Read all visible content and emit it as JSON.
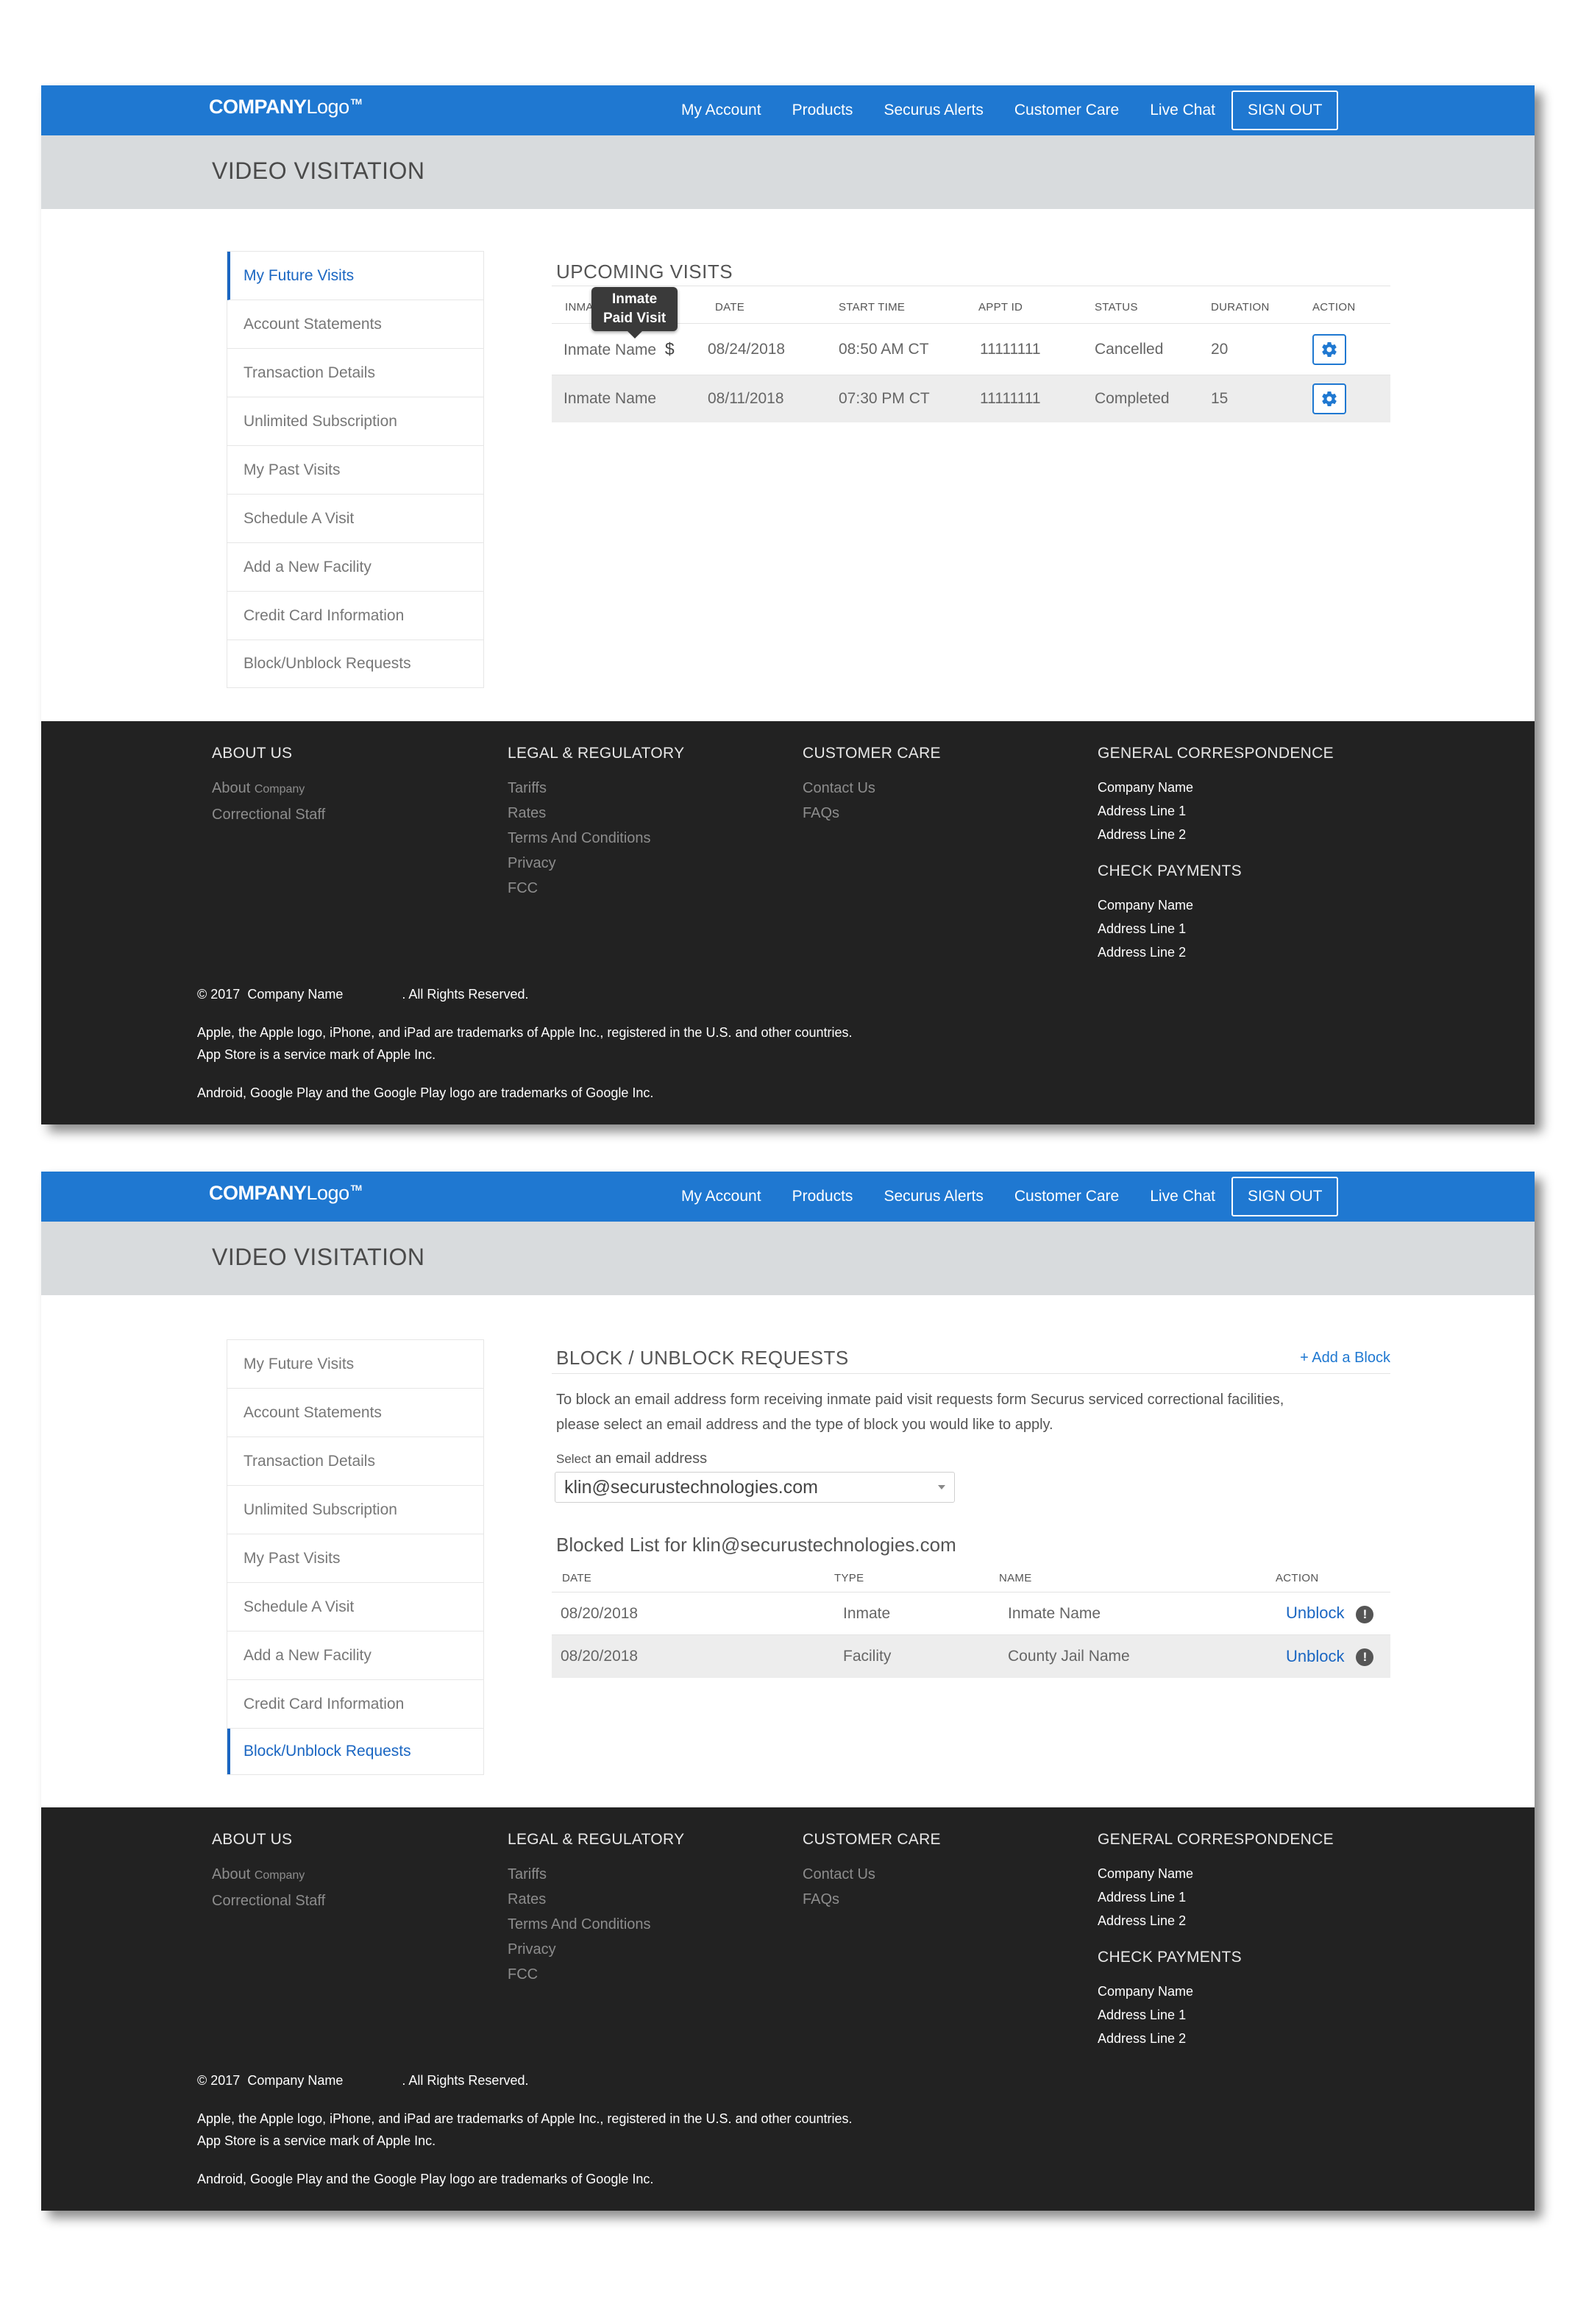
{
  "header": {
    "logo_bold": "COMPANY",
    "logo_light": "Logo",
    "logo_tm": "TM",
    "nav": [
      "My Account",
      "Products",
      "Securus Alerts",
      "Customer Care",
      "Live Chat"
    ],
    "sign_out": "SIGN OUT"
  },
  "page_title": "VIDEO VISITATION",
  "sidebar": {
    "items": [
      "My Future Visits",
      "Account Statements",
      "Transaction Details",
      "Unlimited Subscription",
      "My Past Visits",
      "Schedule A Visit",
      "Add a New Facility",
      "Credit Card Information",
      "Block/Unblock Requests"
    ]
  },
  "screen1": {
    "active_item": "My Future Visits",
    "title": "UPCOMING VISITS",
    "columns": [
      "INMATE NAME",
      "DATE",
      "START TIME",
      "APPT ID",
      "STATUS",
      "DURATION",
      "ACTION"
    ],
    "rows": [
      {
        "name": "Inmate Name",
        "paid": "$",
        "date": "08/24/2018",
        "time": "08:50 AM CT",
        "appt": "11111111",
        "status": "Cancelled",
        "duration": "20"
      },
      {
        "name": "Inmate Name",
        "paid": "",
        "date": "08/11/2018",
        "time": "07:30 PM CT",
        "appt": "11111111",
        "status": "Completed",
        "duration": "15"
      }
    ],
    "tooltip_line1": "Inmate",
    "tooltip_line2": "Paid Visit"
  },
  "screen2": {
    "active_item": "Block/Unblock Requests",
    "title": "BLOCK / UNBLOCK  REQUESTS",
    "add_block": "+ Add a Block",
    "description_line1": "To block an email address form receiving inmate paid visit requests form Securus serviced correctional facilities,",
    "description_line2": "please select an email address and the type of block you would like to apply.",
    "select_label_small": "Select",
    "select_label": "an email address",
    "select_value": "klin@securustechnologies.com",
    "blocked_title": "Blocked List for klin@securustechnologies.com",
    "columns": [
      "DATE",
      "TYPE",
      "NAME",
      "ACTION"
    ],
    "rows": [
      {
        "date": "08/20/2018",
        "type": "Inmate",
        "name": "Inmate Name",
        "action": "Unblock"
      },
      {
        "date": "08/20/2018",
        "type": "Facility",
        "name": "County Jail Name",
        "action": "Unblock"
      }
    ]
  },
  "footer": {
    "about": {
      "title": "ABOUT US",
      "about_label": "About",
      "about_company": "Company",
      "staff": "Correctional Staff"
    },
    "legal": {
      "title": "LEGAL & REGULATORY",
      "links": [
        "Tariffs",
        "Rates",
        "Terms And Conditions",
        "Privacy",
        "FCC"
      ]
    },
    "care": {
      "title": "CUSTOMER CARE",
      "links": [
        "Contact Us",
        "FAQs"
      ]
    },
    "general": {
      "title": "GENERAL CORRESPONDENCE",
      "lines": [
        "Company Name",
        "Address Line 1",
        "Address Line 2"
      ]
    },
    "payments": {
      "title": "CHECK PAYMENTS",
      "lines": [
        "Company Name",
        "Address Line 1",
        "Address Line 2"
      ]
    },
    "copyright_prefix": "© 2017",
    "copyright_company": "Company Name",
    "copyright_suffix": ". All Rights Reserved.",
    "apple_line1": "Apple, the Apple logo, iPhone, and iPad are trademarks of Apple Inc., registered in the U.S. and other countries.",
    "apple_line2": "App Store is a service mark of Apple Inc.",
    "android": "Android, Google Play and the Google Play logo are trademarks of Google Inc."
  },
  "colors": {
    "brand_blue": "#1f78d1",
    "link_blue": "#1a66c2",
    "footer_bg": "#222222",
    "subbar_bg": "#d8dbdd"
  }
}
